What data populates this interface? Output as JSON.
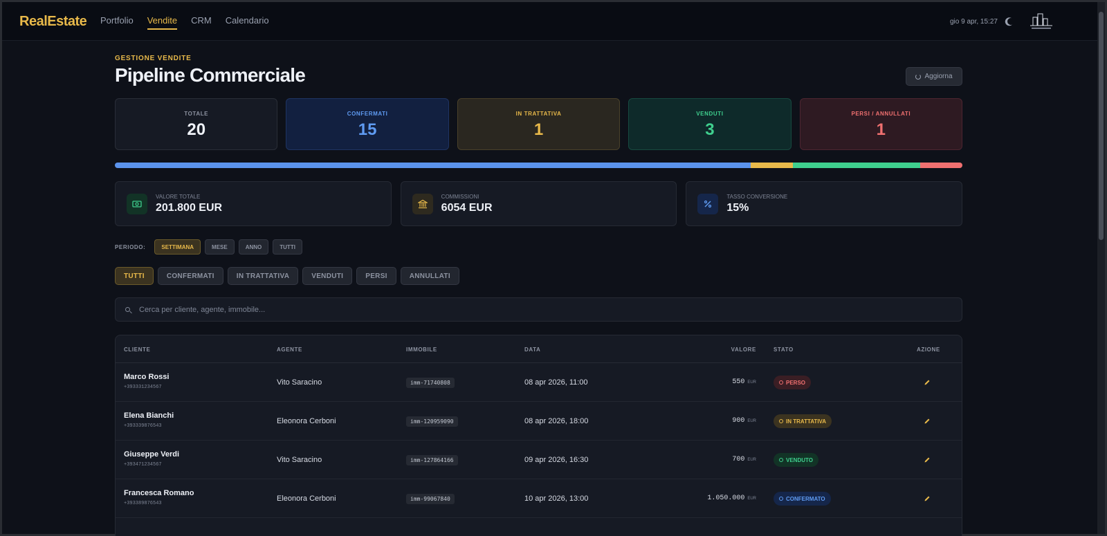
{
  "header": {
    "brand": "RealEstate",
    "nav": [
      {
        "label": "Portfolio",
        "active": false
      },
      {
        "label": "Vendite",
        "active": true
      },
      {
        "label": "CRM",
        "active": false
      },
      {
        "label": "Calendario",
        "active": false
      }
    ],
    "datetime": "gio 9 apr, 15:27",
    "theme_icon": "moon-icon",
    "logo_icon": "building-logo-icon"
  },
  "page": {
    "kicker": "GESTIONE VENDITE",
    "title": "Pipeline Commerciale",
    "refresh_label": "Aggiorna"
  },
  "stats": {
    "total": {
      "label": "TOTALE",
      "value": "20"
    },
    "confirmed": {
      "label": "CONFERMATI",
      "value": "15"
    },
    "negotiating": {
      "label": "IN TRATTATIVA",
      "value": "1"
    },
    "sold": {
      "label": "VENDUTI",
      "value": "3"
    },
    "lost": {
      "label": "PERSI / ANNULLATI",
      "value": "1"
    }
  },
  "progress": [
    {
      "key": "confirmed",
      "fraction": 0.75,
      "color": "#5b93ec"
    },
    {
      "key": "negotiating",
      "fraction": 0.05,
      "color": "#e8b94a"
    },
    {
      "key": "sold",
      "fraction": 0.15,
      "color": "#3fcf8e"
    },
    {
      "key": "lost",
      "fraction": 0.05,
      "color": "#f07070"
    }
  ],
  "metrics": [
    {
      "label": "VALORE TOTALE",
      "value": "201.800 EUR",
      "icon": "banknote-icon",
      "color": "#3fcf8e"
    },
    {
      "label": "COMMISSIONI",
      "value": "6054 EUR",
      "icon": "bank-icon",
      "color": "#e8b94a"
    },
    {
      "label": "TASSO CONVERSIONE",
      "value": "15%",
      "icon": "percent-icon",
      "color": "#5f9bf2"
    }
  ],
  "period": {
    "label": "PERIODO:",
    "options": [
      {
        "label": "SETTIMANA",
        "active": true
      },
      {
        "label": "MESE",
        "active": false
      },
      {
        "label": "ANNO",
        "active": false
      },
      {
        "label": "TUTTI",
        "active": false
      }
    ]
  },
  "status_tabs": [
    {
      "label": "TUTTI",
      "active": true
    },
    {
      "label": "CONFERMATI",
      "active": false
    },
    {
      "label": "IN TRATTATIVA",
      "active": false
    },
    {
      "label": "VENDUTI",
      "active": false
    },
    {
      "label": "PERSI",
      "active": false
    },
    {
      "label": "ANNULLATI",
      "active": false
    }
  ],
  "search": {
    "placeholder": "Cerca per cliente, agente, immobile...",
    "value": ""
  },
  "table": {
    "columns": {
      "client": "CLIENTE",
      "agent": "AGENTE",
      "property": "IMMOBILE",
      "date": "DATA",
      "value": "VALORE",
      "status": "STATO",
      "action": "AZIONE"
    },
    "currency": "EUR",
    "rows": [
      {
        "client": "Marco Rossi",
        "phone": "+393331234567",
        "agent": "Vito Saracino",
        "property": "imm-71740808",
        "date": "08 apr 2026, 11:00",
        "value": "550",
        "status": "PERSO",
        "status_class": "perso"
      },
      {
        "client": "Elena Bianchi",
        "phone": "+393339876543",
        "agent": "Eleonora Cerboni",
        "property": "imm-120959090",
        "date": "08 apr 2026, 18:00",
        "value": "900",
        "status": "IN TRATTATIVA",
        "status_class": "tratt"
      },
      {
        "client": "Giuseppe Verdi",
        "phone": "+393471234567",
        "agent": "Vito Saracino",
        "property": "imm-127864166",
        "date": "09 apr 2026, 16:30",
        "value": "700",
        "status": "VENDUTO",
        "status_class": "vend"
      },
      {
        "client": "Francesca Romano",
        "phone": "+393389876543",
        "agent": "Eleonora Cerboni",
        "property": "imm-99067840",
        "date": "10 apr 2026, 13:00",
        "value": "1.050.000",
        "status": "CONFERMATO",
        "status_class": "conf"
      }
    ]
  }
}
